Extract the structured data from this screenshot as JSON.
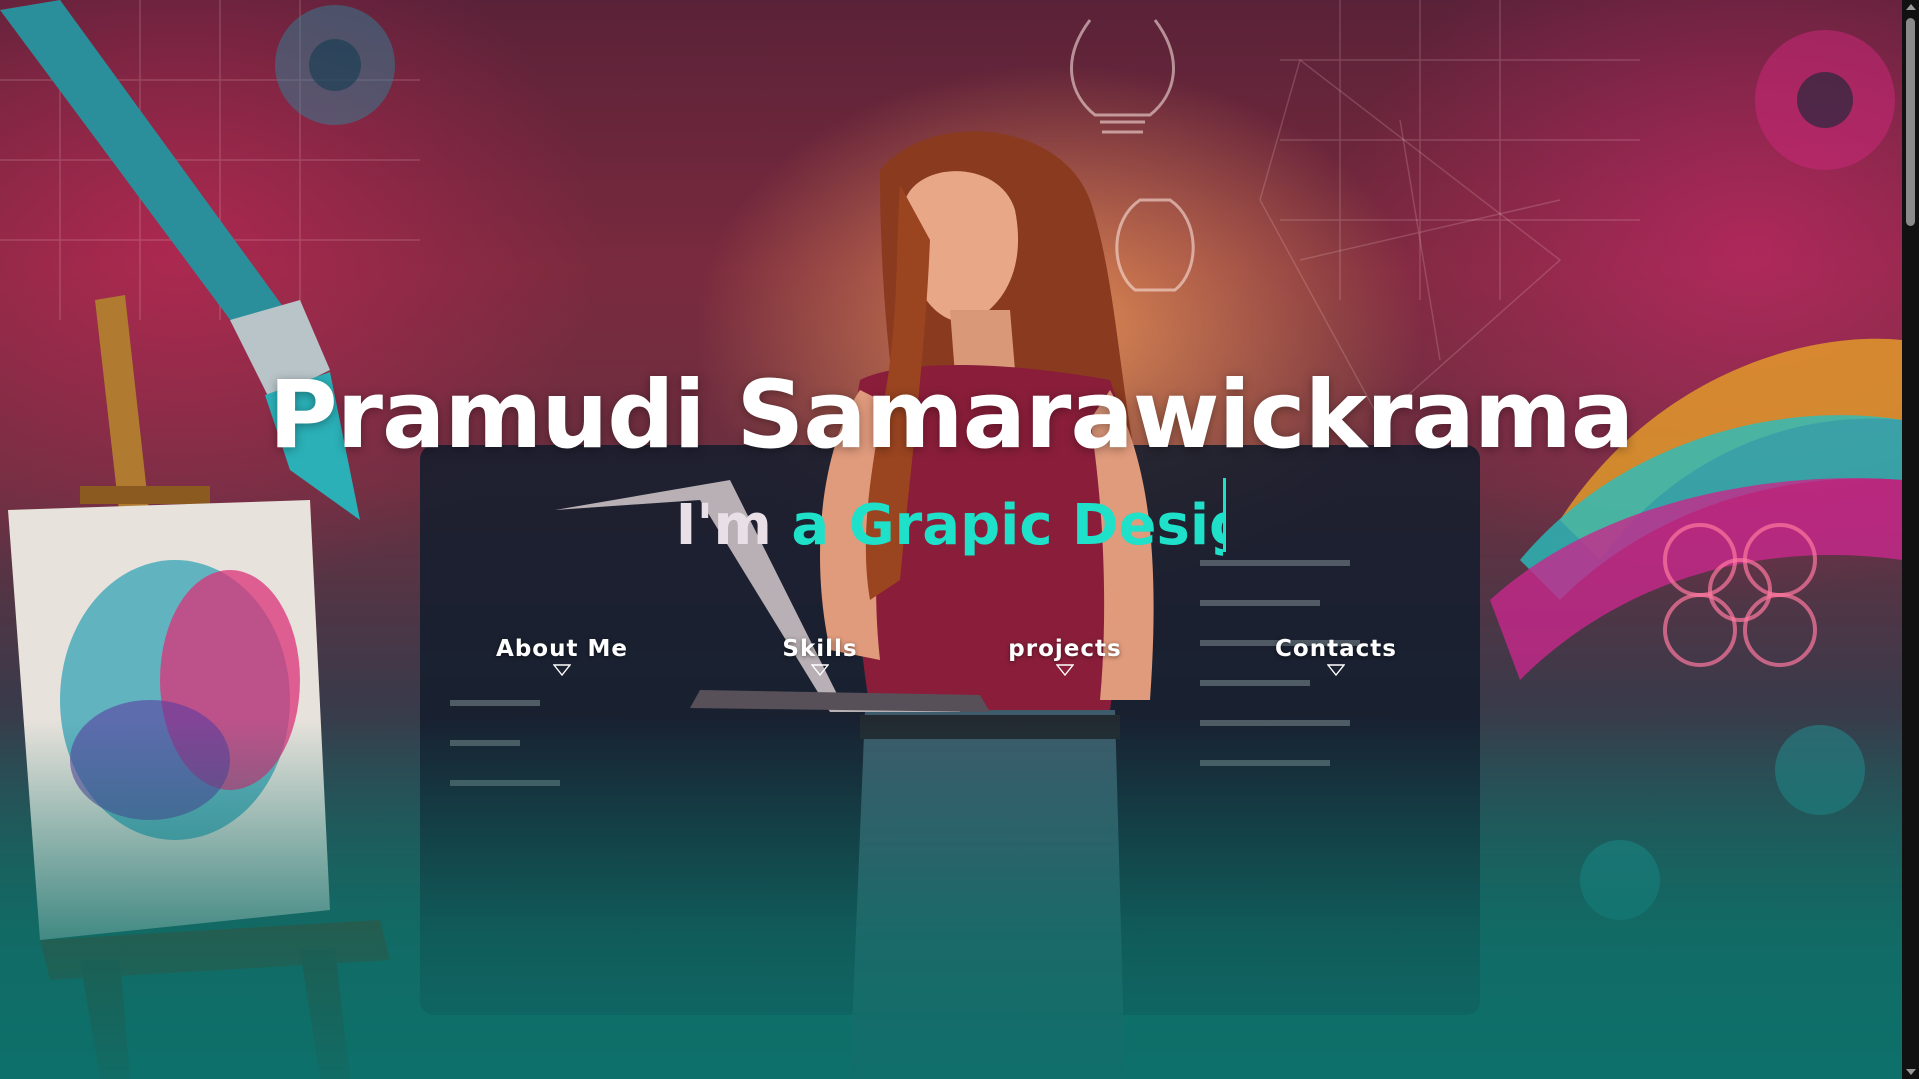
{
  "hero": {
    "name": "Pramudi Samarawickrama",
    "subtitle_static": "I'm",
    "subtitle_typed": "a Grapic Desig",
    "background": "illustration-designer-with-laptop"
  },
  "nav": {
    "items": [
      {
        "label": "About Me",
        "icon": "chevron-down-icon"
      },
      {
        "label": "Skills",
        "icon": "chevron-down-icon"
      },
      {
        "label": "projects",
        "icon": "chevron-down-icon"
      },
      {
        "label": "Contacts",
        "icon": "chevron-down-icon"
      }
    ]
  },
  "colors": {
    "accent": "#1fe0c8",
    "title": "#ffffff",
    "bottom_teal": "#0f6e68"
  }
}
